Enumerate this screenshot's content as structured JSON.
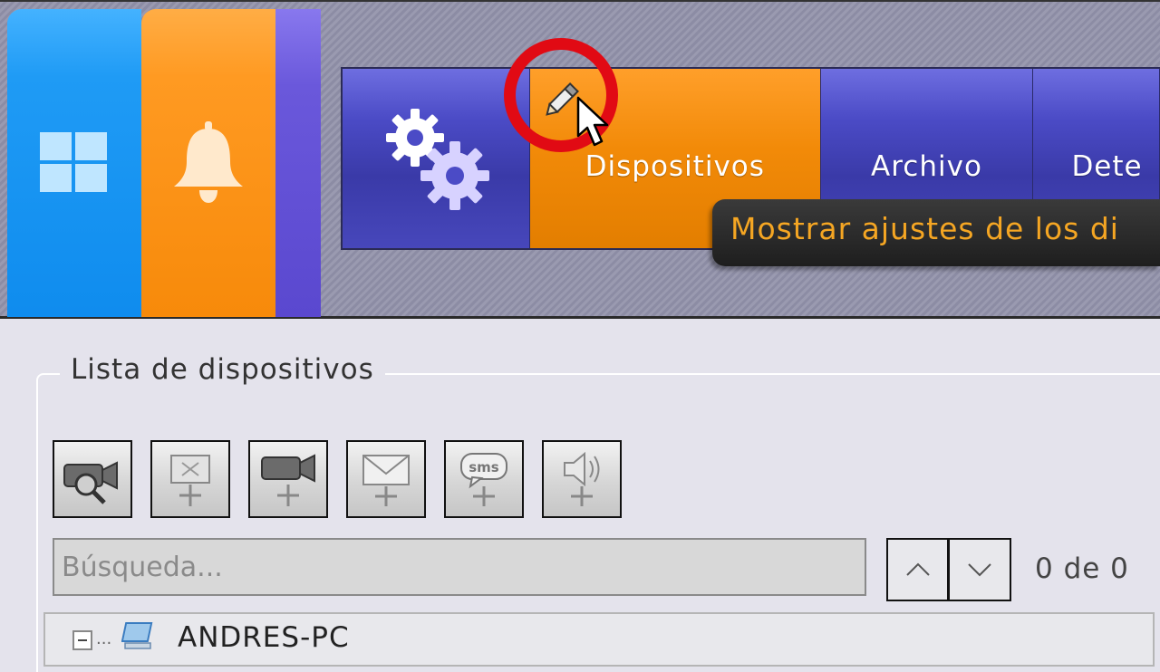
{
  "launcher": {
    "tiles": [
      {
        "name": "windows",
        "icon": "windows-logo-icon",
        "color": "#1f9bf5"
      },
      {
        "name": "notifications",
        "icon": "bell-icon",
        "color": "#ff9a22"
      },
      {
        "name": "extra",
        "icon": "none",
        "color": "#6a58db"
      }
    ]
  },
  "menu": {
    "settings_icon": "gears-icon",
    "items": [
      {
        "label": "Dispositivos",
        "active": true,
        "icon": "pencil-icon"
      },
      {
        "label": "Archivo",
        "active": false
      },
      {
        "label": "Dete",
        "active": false
      }
    ],
    "tooltip": "Mostrar ajustes de los di"
  },
  "device_panel": {
    "title": "Lista de dispositivos",
    "toolbar": [
      {
        "icon": "camera-search-icon"
      },
      {
        "icon": "add-screen-icon"
      },
      {
        "icon": "add-camera-icon"
      },
      {
        "icon": "add-email-icon"
      },
      {
        "icon": "add-sms-icon"
      },
      {
        "icon": "add-sound-icon"
      }
    ],
    "search": {
      "placeholder": "Búsqueda..."
    },
    "nav": {
      "prev_icon": "chevron-up-icon",
      "next_icon": "chevron-down-icon"
    },
    "match_count": "0 de 0",
    "tree": [
      {
        "label": "ANDRES-PC",
        "icon": "computer-icon",
        "expanded": true
      }
    ]
  },
  "colors": {
    "accent_orange": "#f28a08",
    "menu_blue": "#4b4bc6",
    "tooltip_text": "#f5a623",
    "highlight_red": "#e10a14"
  }
}
